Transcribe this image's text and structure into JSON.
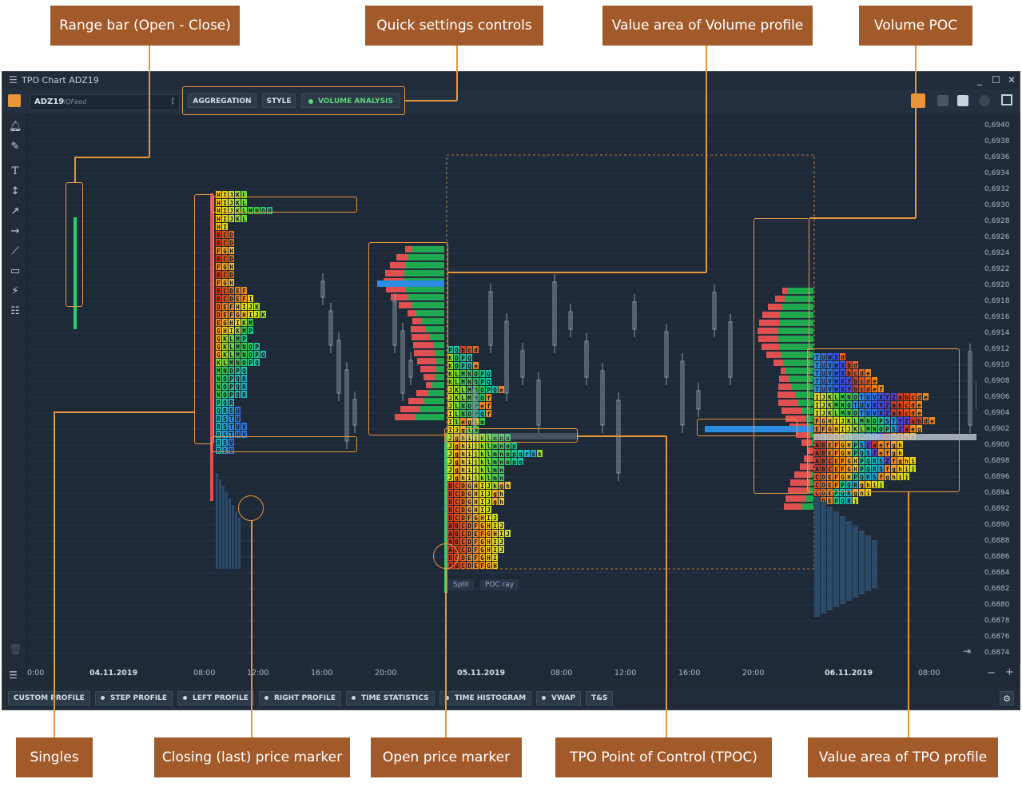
{
  "window": {
    "title": "TPO Chart ADZ19",
    "symbol": "ADZ19",
    "feed": "IQFeed"
  },
  "toolbar": {
    "aggregation": "AGGREGATION",
    "style": "STYLE",
    "volume_analysis": "VOLUME ANALYSIS"
  },
  "callouts": {
    "range_bar": "Range bar (Open - Close)",
    "quick_settings": "Quick settings controls",
    "value_area_volume": "Value area of Volume profile",
    "volume_poc": "Volume POC",
    "singles": "Singles",
    "closing_price": "Closing (last) price marker",
    "open_price": "Open price marker",
    "tpoc": "TPO Point of Control (TPOC)",
    "value_area_tpo": "Value area of TPO profile"
  },
  "chart": {
    "split_label": "Split",
    "poc_ray_label": "POC ray",
    "y_ticks": [
      "0,6940",
      "0,6938",
      "0,6936",
      "0,6934",
      "0,6932",
      "0,6930",
      "0,6928",
      "0,6926",
      "0,6924",
      "0,6922",
      "0,6920",
      "0,6918",
      "0,6916",
      "0,6914",
      "0,6912",
      "0,6910",
      "0,6908",
      "0,6906",
      "0,6904",
      "0,6902",
      "0,6900",
      "0,6898",
      "0,6896",
      "0,6894",
      "0,6892",
      "0,6890",
      "0,6888",
      "0,6886",
      "0,6884",
      "0,6882",
      "0,6880",
      "0,6878",
      "0,6876",
      "0,6874"
    ],
    "x_ticks": [
      {
        "label": "0:00",
        "bold": false
      },
      {
        "label": "04.11.2019",
        "bold": true
      },
      {
        "label": "08:00",
        "bold": false
      },
      {
        "label": "12:00",
        "bold": false
      },
      {
        "label": "16:00",
        "bold": false
      },
      {
        "label": "20:00",
        "bold": false
      },
      {
        "label": "05.11.2019",
        "bold": true
      },
      {
        "label": "08:00",
        "bold": false
      },
      {
        "label": "12:00",
        "bold": false
      },
      {
        "label": "16:00",
        "bold": false
      },
      {
        "label": "20:00",
        "bold": false
      },
      {
        "label": "06.11.2019",
        "bold": true
      },
      {
        "label": "08:00",
        "bold": false
      }
    ],
    "day1_tpo_rows": [
      "HIJKL",
      "HIJKL",
      "HIJKLMNOP",
      "HIJKL",
      "HI",
      "BCD",
      "BCD",
      "FGH",
      "BCD",
      "FGH",
      "BCD",
      "FGH",
      "BCDEF",
      "BCDEFI",
      "DEFHIJK",
      "DEFGHIJK",
      "EGHIKM",
      "GHIKMP",
      "GKLMP",
      "GKLMNOP",
      "GKLMNOPQ",
      "KLMNOPQ",
      "MNOPQ",
      "NOPQR",
      "NOPQR",
      "NOPQR",
      "PQR",
      "QRSU",
      "RSTU",
      "RSTUV",
      "RSTUV",
      "RSV",
      "RSV"
    ],
    "day2_tpo_rows": [
      "PQbcd",
      "KOPQ",
      "KOPQe",
      "KLMNOPQ",
      "KLMNOPQ",
      "JKLMNOPQe",
      "JKLMNOf",
      "JLNOPef",
      "ILNOPQf",
      "Ilegim",
      "IJglm",
      "Jghijklmno",
      "Jghijklmnop",
      "Jghijklmnopqrsk",
      "Jghijklmnopq",
      "Jghijklmn",
      "Jghijklmn",
      "BCDGHIJkgh",
      "BCDGHIJgh",
      "BCDGHIJgh",
      "BCDGHIJ",
      "BCDFGHIJ",
      "ABCDFGHIJ",
      "ABCDEFGHIJ",
      "ABCDFGHIJ",
      "ABCDFGHIJ",
      "BCDEFGHI",
      "ABCDEFGH"
    ],
    "day3_tpo_rows": [
      "TUWXd",
      "TUVWXbd",
      "TUVWXbcde",
      "TUVWXYbcde",
      "TUVWXYbcdef",
      "IJKLMNOTUVXYZabcde",
      "IJKMNOTUVXYZabcde",
      "IJKLMNOTUVXZabcde",
      "FGHIJKLMNOPSTYZabde",
      "EFGHIJKLMNOPSZaeg",
      "AEFGHLOPSTZaefgh",
      "ABEFGHPSZaefgh",
      "ABEFGHPQSZefgh",
      "ABCEFGHPQRSZfghi",
      "ABCEFGHPQRSfghij",
      "CDEFGHPQRSfghij",
      "CDEFPQRghij",
      "CDEPQRghi",
      "CDEPQRj"
    ]
  },
  "bottom": {
    "buttons": [
      {
        "label": "CUSTOM PROFILE",
        "dot": false
      },
      {
        "label": "STEP PROFILE",
        "dot": true
      },
      {
        "label": "LEFT PROFILE",
        "dot": true
      },
      {
        "label": "RIGHT PROFILE",
        "dot": true
      },
      {
        "label": "TIME STATISTICS",
        "dot": true
      },
      {
        "label": "TIME HISTOGRAM",
        "dot": true
      },
      {
        "label": "VWAP",
        "dot": true
      },
      {
        "label": "T&S",
        "dot": false
      }
    ]
  },
  "colors": {
    "accent": "#e8963c",
    "callout_bg": "#a35a2a",
    "chart_bg": "#1f2a38",
    "volume_green": "#1fa84f",
    "volume_red": "#e05050",
    "poc_blue": "#2b8ce0"
  },
  "icons": [
    "menu-icon",
    "minimize-icon",
    "maximize-icon",
    "close-icon",
    "panel-toggle-icon",
    "bell-icon",
    "pencil-icon",
    "text-icon",
    "vertical-line-icon",
    "arrow-icon",
    "horizontal-line-icon",
    "trend-line-icon",
    "rectangle-icon",
    "fibonacci-icon",
    "ruler-icon",
    "trash-icon",
    "list-icon",
    "gear-icon"
  ]
}
